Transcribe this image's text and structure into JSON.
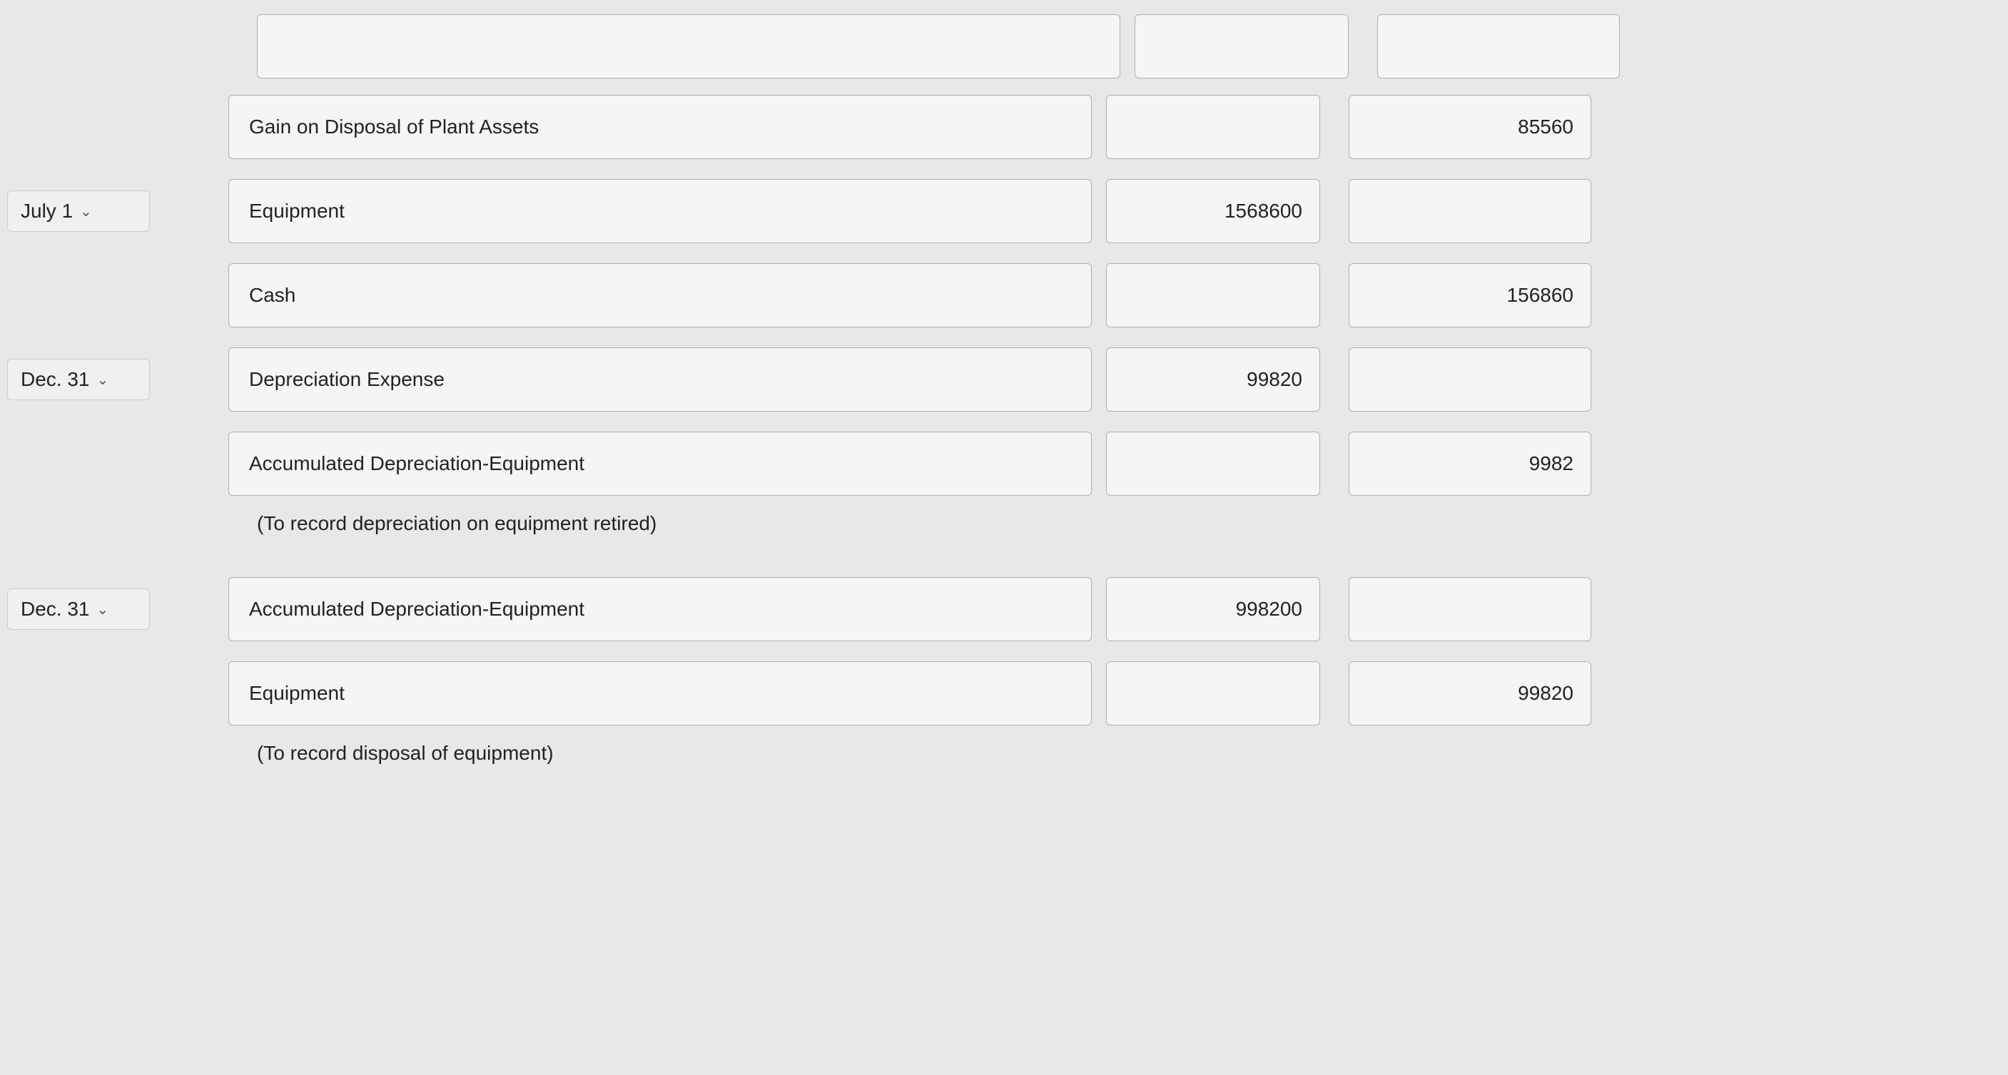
{
  "rows": [
    {
      "id": "top-row",
      "date": null,
      "account": null,
      "debit": null,
      "credit": null,
      "type": "top-border"
    },
    {
      "id": "gain-row",
      "date": null,
      "account": "Gain on Disposal of Plant Assets",
      "debit": "",
      "credit": "85560",
      "type": "entry",
      "indented": false
    },
    {
      "id": "july1-equipment-row",
      "date": "July 1",
      "account": "Equipment",
      "debit": "1568600",
      "credit": "",
      "type": "entry",
      "indented": false
    },
    {
      "id": "cash-row",
      "date": null,
      "account": "Cash",
      "debit": "",
      "credit": "156860",
      "type": "entry",
      "indented": false
    },
    {
      "id": "dec31-depreciation-row",
      "date": "Dec. 31",
      "account": "Depreciation Expense",
      "debit": "99820",
      "credit": "",
      "type": "entry",
      "indented": false
    },
    {
      "id": "accum-dep-row",
      "date": null,
      "account": "Accumulated Depreciation-Equipment",
      "debit": "",
      "credit": "9982",
      "type": "entry",
      "indented": false
    },
    {
      "id": "note1-row",
      "note": "(To record depreciation on equipment retired)",
      "type": "note"
    },
    {
      "id": "dec31-accum-row",
      "date": "Dec. 31",
      "account": "Accumulated Depreciation-Equipment",
      "debit": "998200",
      "credit": "",
      "type": "entry",
      "indented": false
    },
    {
      "id": "equipment2-row",
      "date": null,
      "account": "Equipment",
      "debit": "",
      "credit": "99820",
      "type": "entry",
      "indented": false
    },
    {
      "id": "note2-row",
      "note": "(To record disposal of equipment)",
      "type": "note"
    }
  ]
}
